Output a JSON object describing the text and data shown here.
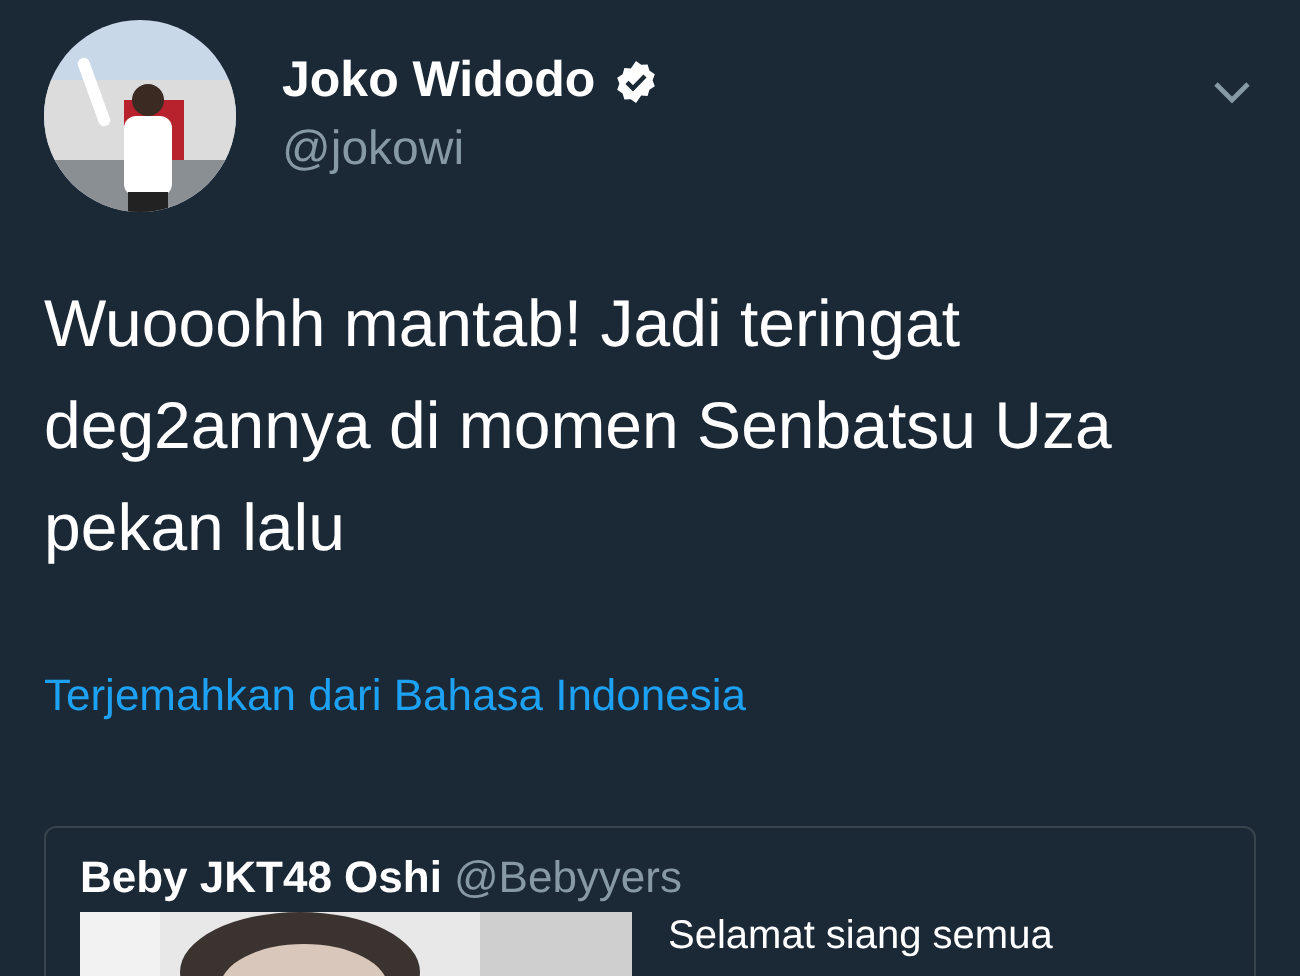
{
  "author": {
    "name": "Joko Widodo",
    "verified": true,
    "handle": "@jokowi"
  },
  "tweet": {
    "text": "Wuooohh mantab! Jadi teringat deg2annya di momen Senbatsu Uza pekan lalu"
  },
  "translate_link": "Terjemahkan dari Bahasa Indonesia",
  "quoted_tweet": {
    "name": "Beby JKT48 Oshi",
    "handle": "@Bebyyers",
    "text": "Selamat siang semua"
  }
}
